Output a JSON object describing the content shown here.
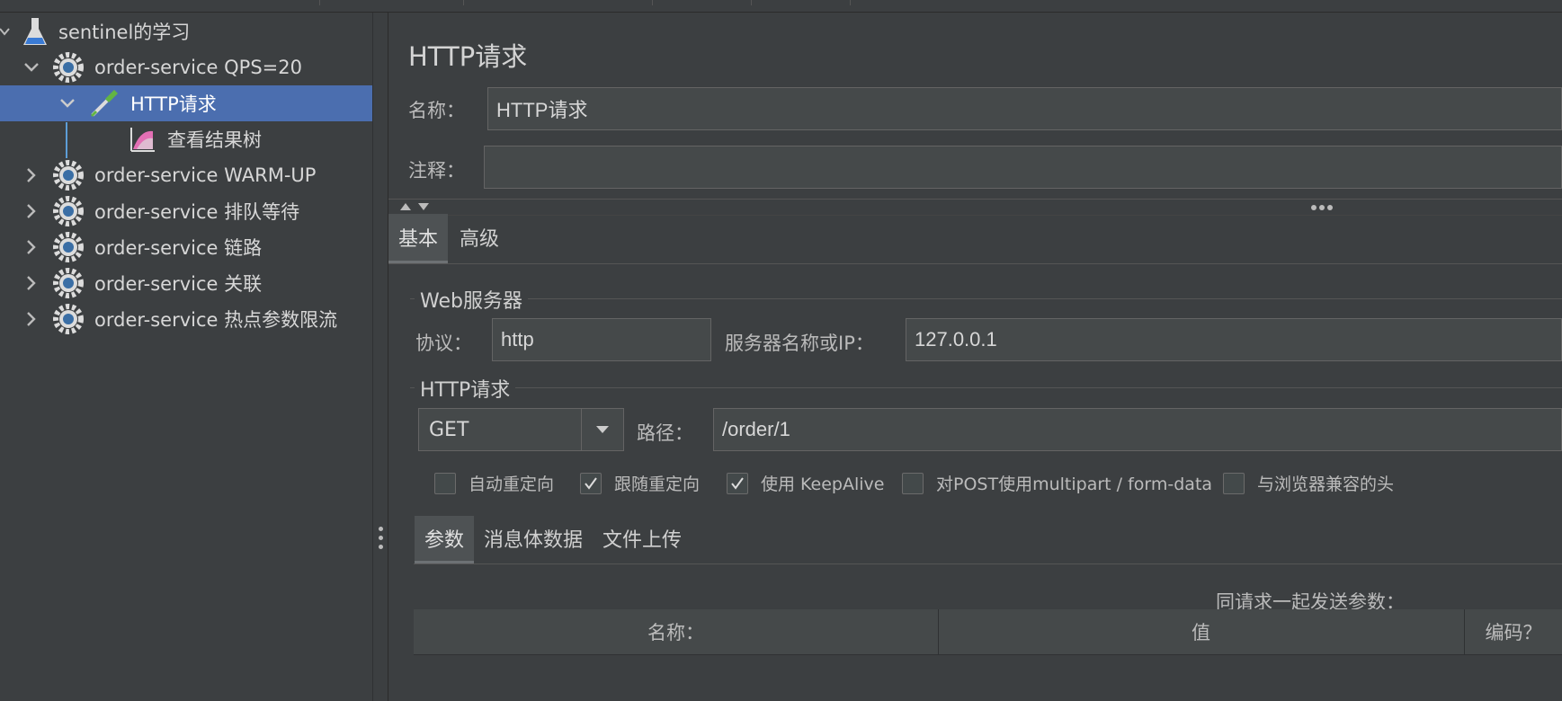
{
  "tree": {
    "items": [
      {
        "label": "sentinel的学习",
        "icon": "flask-icon"
      },
      {
        "label": "order-service QPS=20",
        "icon": "gear-icon"
      },
      {
        "label": "HTTP请求",
        "icon": "pipette-icon"
      },
      {
        "label": "查看结果树",
        "icon": "chart-icon"
      },
      {
        "label": "order-service WARM-UP",
        "icon": "gear-icon"
      },
      {
        "label": "order-service 排队等待",
        "icon": "gear-icon"
      },
      {
        "label": "order-service 链路",
        "icon": "gear-icon"
      },
      {
        "label": "order-service 关联",
        "icon": "gear-icon"
      },
      {
        "label": "order-service 热点参数限流",
        "icon": "gear-icon"
      }
    ],
    "selected_index": 2
  },
  "panel": {
    "title": "HTTP请求",
    "name_label": "名称：",
    "name_value": "HTTP请求",
    "comment_label": "注释：",
    "comment_value": ""
  },
  "tabs": [
    {
      "label": "基本",
      "active": true
    },
    {
      "label": "高级",
      "active": false
    }
  ],
  "web_server": {
    "group_title": "Web服务器",
    "protocol_label": "协议：",
    "protocol_value": "http",
    "server_label": "服务器名称或IP：",
    "server_value": "127.0.0.1"
  },
  "http_request": {
    "group_title": "HTTP请求",
    "method": "GET",
    "path_label": "路径：",
    "path_value": "/order/1"
  },
  "checkboxes": [
    {
      "label": "自动重定向",
      "checked": false
    },
    {
      "label": "跟随重定向",
      "checked": true
    },
    {
      "label": "使用 KeepAlive",
      "checked": true
    },
    {
      "label": "对POST使用multipart / form-data",
      "checked": false
    },
    {
      "label": "与浏览器兼容的头",
      "checked": false
    }
  ],
  "subtabs": [
    {
      "label": "参数",
      "active": true
    },
    {
      "label": "消息体数据",
      "active": false
    },
    {
      "label": "文件上传",
      "active": false
    }
  ],
  "params": {
    "caption": "同请求一起发送参数：",
    "columns": [
      "名称：",
      "值",
      "编码？"
    ]
  },
  "colors": {
    "background": "#3c3f41",
    "selection": "#4b6eaf",
    "input_bg": "#45494a"
  }
}
